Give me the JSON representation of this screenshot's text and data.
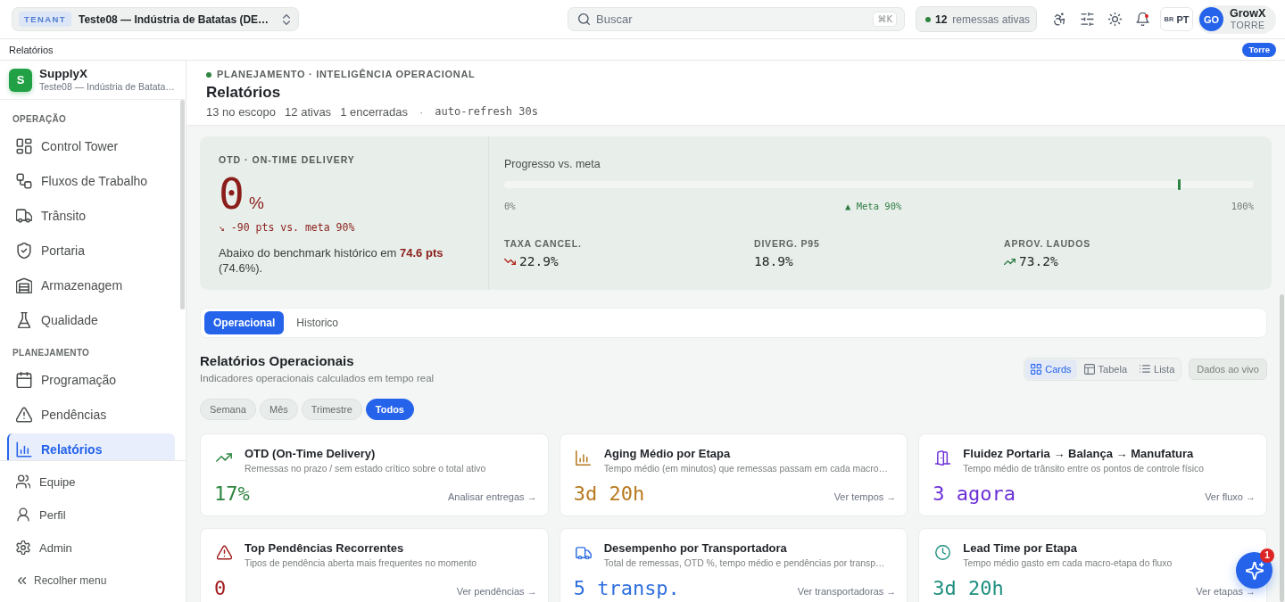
{
  "top_bar": {
    "tenant": {
      "badge": "TENANT",
      "name": "Teste08 — Indústria de Batatas (DE…"
    },
    "search": {
      "placeholder": "Buscar",
      "shortcut": "⌘K"
    },
    "active_shipments": {
      "count": "12",
      "label": "remessas ativas"
    },
    "notifications": {
      "alert": true
    },
    "language": {
      "flag": "BR",
      "code": "PT"
    },
    "user": {
      "initials": "GO",
      "name": "GrowX",
      "role": "TORRE"
    }
  },
  "breadcrumb": {
    "title": "Relatórios",
    "badge": "Torre"
  },
  "sidebar": {
    "brand": {
      "logo": "S",
      "name": "SupplyX",
      "tenant": "Teste08 — Indústria de Batata…"
    },
    "sections": [
      {
        "title": "OPERAÇÃO",
        "items": [
          {
            "label": "Control Tower",
            "selected": false
          },
          {
            "label": "Fluxos de Trabalho",
            "selected": false
          },
          {
            "label": "Trânsito",
            "selected": false
          },
          {
            "label": "Portaria",
            "selected": false
          },
          {
            "label": "Armazenagem",
            "selected": false
          },
          {
            "label": "Qualidade",
            "selected": false
          }
        ]
      },
      {
        "title": "PLANEJAMENTO",
        "items": [
          {
            "label": "Programação",
            "selected": false
          },
          {
            "label": "Pendências",
            "selected": false
          },
          {
            "label": "Relatórios",
            "selected": true
          }
        ]
      }
    ],
    "footer_items": [
      {
        "label": "Equipe",
        "selected": false
      },
      {
        "label": "Perfil",
        "selected": false
      },
      {
        "label": "Admin",
        "selected": false
      }
    ],
    "collapse_button": "Recolher menu"
  },
  "header": {
    "eyebrow": "PLANEJAMENTO · INTELIGÊNCIA OPERACIONAL",
    "title": "Relatórios",
    "counts": [
      "13 no escopo",
      "12 ativas",
      "1 encerradas"
    ],
    "separator": "·",
    "refresh": "auto-refresh 30s"
  },
  "otd_panel": {
    "label": "OTD · ON-TIME DELIVERY",
    "value": "0",
    "unit": "%",
    "delta": "↘ -90 pts vs. meta 90%",
    "note": "Abaixo do benchmark histórico em **74.6 pts** (74.6%).",
    "progress": {
      "title": "Progresso vs. meta",
      "level": 0,
      "goal": {
        "level": 0.9,
        "label": "▲ Meta 90%"
      },
      "min_label": "0%",
      "max_label": "100%"
    },
    "metrics": [
      {
        "label": "TAXA CANCEL.",
        "value": "22.9%",
        "kind": "falling"
      },
      {
        "label": "DIVERG. P95",
        "value": "18.9%",
        "kind": "plain"
      },
      {
        "label": "APROV. LAUDOS",
        "value": "73.2%",
        "kind": "rising"
      }
    ]
  },
  "tabs": [
    {
      "label": "Operacional",
      "selected": true
    },
    {
      "label": "Historico",
      "selected": false
    }
  ],
  "section": {
    "title": "Relatórios Operacionais",
    "subtitle": "Indicadores operacionais calculados em tempo real",
    "views": [
      {
        "label": "Cards",
        "selected": true
      },
      {
        "label": "Tabela",
        "selected": false
      },
      {
        "label": "Lista",
        "selected": false
      }
    ],
    "live_button": "Dados ao vivo"
  },
  "periods": [
    {
      "label": "Semana",
      "selected": false
    },
    {
      "label": "Mês",
      "selected": false
    },
    {
      "label": "Trimestre",
      "selected": false
    },
    {
      "label": "Todos",
      "selected": true
    }
  ],
  "reports": [
    {
      "title": "OTD (On-Time Delivery)",
      "description": "Remessas no prazo / sem estado crítico sobre o total ativo",
      "value": "17%",
      "link": "Analisar entregas →",
      "color": "#2e8540"
    },
    {
      "title": "Aging Médio por Etapa",
      "description": "Tempo médio (em minutos) que remessas passam em cada macro…",
      "value": "3d 20h",
      "link": "Ver tempos →",
      "color": "#b7791f"
    },
    {
      "title": "Fluidez Portaria → Balança → Manufatura",
      "description": "Tempo médio de trânsito entre os pontos de controle físico",
      "value": "3 agora",
      "link": "Ver fluxo →",
      "color": "#6b2fd6"
    },
    {
      "title": "Top Pendências Recorrentes",
      "description": "Tipos de pendência aberta mais frequentes no momento",
      "value": "0",
      "link": "Ver pendências →",
      "color": "#a11d1d"
    },
    {
      "title": "Desempenho por Transportadora",
      "description": "Total de remessas, OTD %, tempo médio e pendências por transp…",
      "value": "5 transp.",
      "link": "Ver transportadoras →",
      "color": "#2f6fdf"
    },
    {
      "title": "Lead Time por Etapa",
      "description": "Tempo médio gasto em cada macro-etapa do fluxo",
      "value": "3d 20h",
      "link": "Ver etapas →",
      "color": "#1f8f80"
    }
  ],
  "assistant_button": {
    "badge": "1"
  }
}
